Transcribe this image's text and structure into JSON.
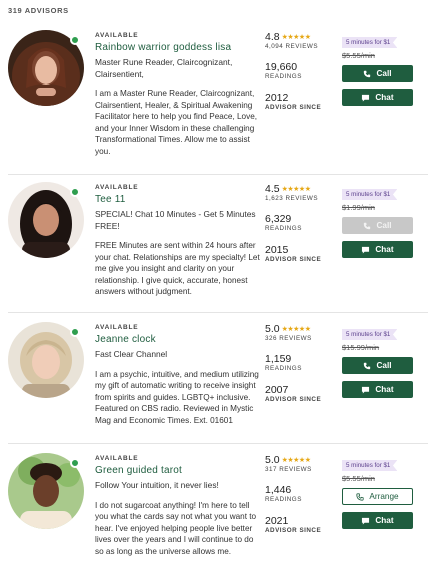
{
  "header": {
    "advisor_count": "319 ADVISORS"
  },
  "labels": {
    "available": "AVAILABLE",
    "reviews_suffix": "REVIEWS",
    "readings": "READINGS",
    "advisor_since": "ADVISOR SINCE",
    "call": "Call",
    "chat": "Chat",
    "arrange": "Arrange"
  },
  "colors": {
    "brand_green": "#1f5d3f",
    "online_dot": "#2f9e4f",
    "star": "#e6a817",
    "promo_bg": "#ebe3f6",
    "promo_text": "#5b3f8c"
  },
  "advisors": [
    {
      "status": "AVAILABLE",
      "name": "Rainbow warrior goddess lisa",
      "tagline": "Master Rune Reader, Claircognizant, Clairsentient,",
      "bio": "I am a Master Rune Reader, Claircognizant, Clairsentient, Healer, & Spiritual Awakening Facilitator here to help you find Peace, Love, and your Inner Wisdom in these challenging Transformational Times. Allow me to assist you.",
      "rating": "4.8",
      "stars": "★★★★★",
      "reviews": "4,094 REVIEWS",
      "readings": "19,660",
      "since": "2012",
      "promo": "5 minutes for $1",
      "old_price": "$5.55/min",
      "call_state": "enabled"
    },
    {
      "status": "AVAILABLE",
      "name": "Tee 11",
      "tagline": "SPECIAL! Chat 10 Minutes - Get 5 Minutes FREE!",
      "bio": "FREE Minutes are sent within 24 hours after your chat. Relationships are my specialty! Let me give you insight and clarity on your relationship. I give quick, accurate, honest answers without judgment.",
      "rating": "4.5",
      "stars": "★★★★★",
      "reviews": "1,623 REVIEWS",
      "readings": "6,329",
      "since": "2015",
      "promo": "5 minutes for $1",
      "old_price": "$1.99/min",
      "call_state": "disabled"
    },
    {
      "status": "AVAILABLE",
      "name": "Jeanne clock",
      "tagline": "Fast Clear Channel",
      "bio": "I am a psychic, intuitive, and medium utilizing my gift of automatic writing to receive insight from spirits and guides. LGBTQ+ inclusive. Featured on CBS radio. Reviewed in Mystic Mag and Economic Times. Ext. 01601",
      "rating": "5.0",
      "stars": "★★★★★",
      "reviews": "326 REVIEWS",
      "readings": "1,159",
      "since": "2007",
      "promo": "5 minutes for $1",
      "old_price": "$15.99/min",
      "call_state": "enabled"
    },
    {
      "status": "AVAILABLE",
      "name": "Green guided tarot",
      "tagline": "Follow Your intuition, it never lies!",
      "bio": "I do not sugarcoat anything! I'm here to tell you what the cards say not what you want to hear. I've enjoyed helping people live better lives over the years and I will continue to do so as long as the universe allows me.",
      "rating": "5.0",
      "stars": "★★★★★",
      "reviews": "317 REVIEWS",
      "readings": "1,446",
      "since": "2021",
      "promo": "5 minutes for $1",
      "old_price": "$5.55/min",
      "call_state": "arrange"
    }
  ]
}
